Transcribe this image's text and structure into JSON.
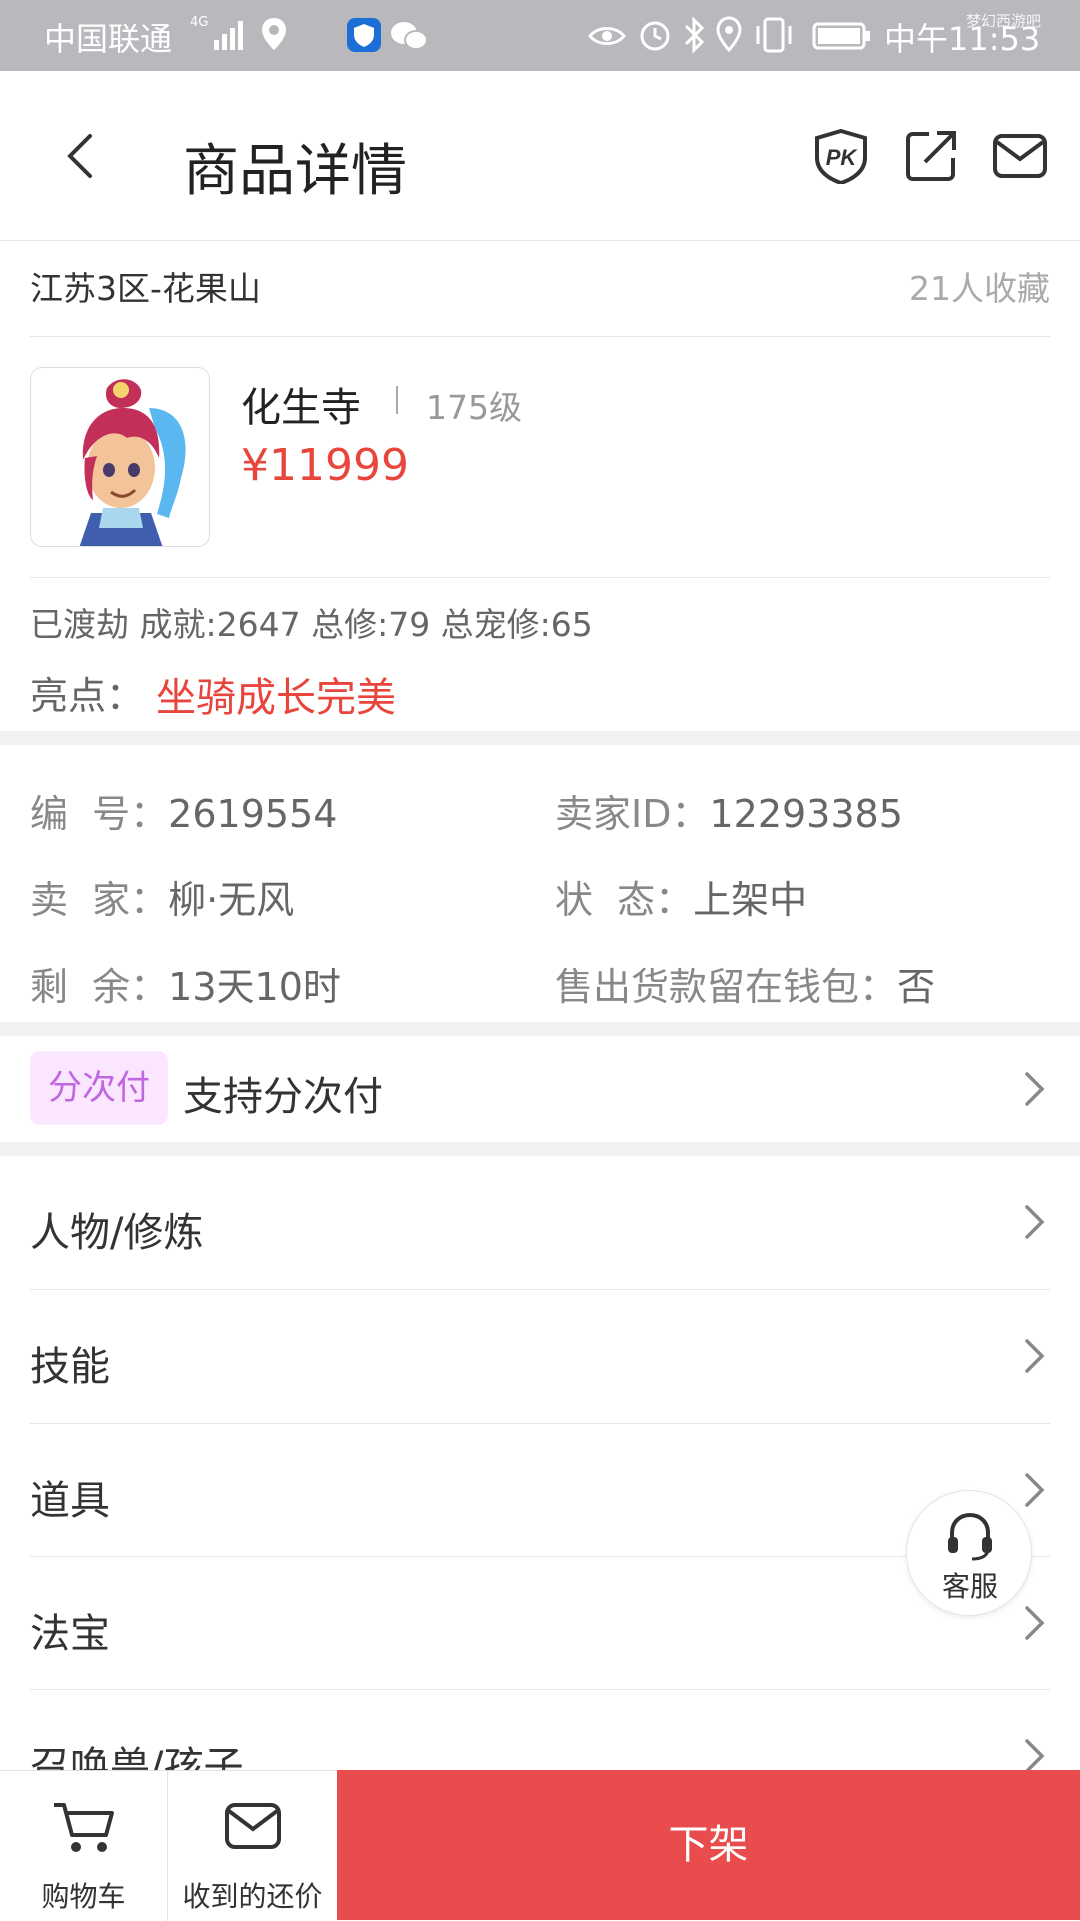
{
  "status_bar": {
    "carrier": "中国联通",
    "network": "4G",
    "time": "中午11:53",
    "watermark": "梦幻西游吧"
  },
  "header": {
    "title": "商品详情",
    "icons": [
      "back-icon",
      "pk-icon",
      "share-icon",
      "mail-icon"
    ]
  },
  "listing": {
    "region": "江苏3区-花果山",
    "favorites": "21人收藏",
    "school": "化生寺",
    "level": "175级",
    "price": "¥11999",
    "stats": "已渡劫 成就:2647 总修:79 总宠修:65",
    "highlight_label": "亮点：",
    "highlight_value": "坐骑成长完美"
  },
  "info": {
    "number_label": "编  号：",
    "number_value": "2619554",
    "seller_id_label": "卖家ID：",
    "seller_id_value": "12293385",
    "seller_label": "卖  家：",
    "seller_value": "柳·无风",
    "status_label": "状  态：",
    "status_value": "上架中",
    "remaining_label": "剩  余：",
    "remaining_value": "13天10时",
    "wallet_label": "售出货款留在钱包：",
    "wallet_value": "否"
  },
  "installment": {
    "tag": "分次付",
    "text": "支持分次付"
  },
  "sections": [
    {
      "label": "人物/修炼"
    },
    {
      "label": "技能"
    },
    {
      "label": "道具"
    },
    {
      "label": "法宝"
    },
    {
      "label": "召唤兽/孩子"
    }
  ],
  "customer_service": {
    "label": "客服"
  },
  "bottom_bar": {
    "cart": "购物车",
    "offers": "收到的还价",
    "delist": "下架"
  },
  "colors": {
    "price_red": "#e8453c",
    "delist_red": "#e84c4c",
    "tag_bg": "#fbe6ff",
    "tag_text": "#c066e0"
  }
}
